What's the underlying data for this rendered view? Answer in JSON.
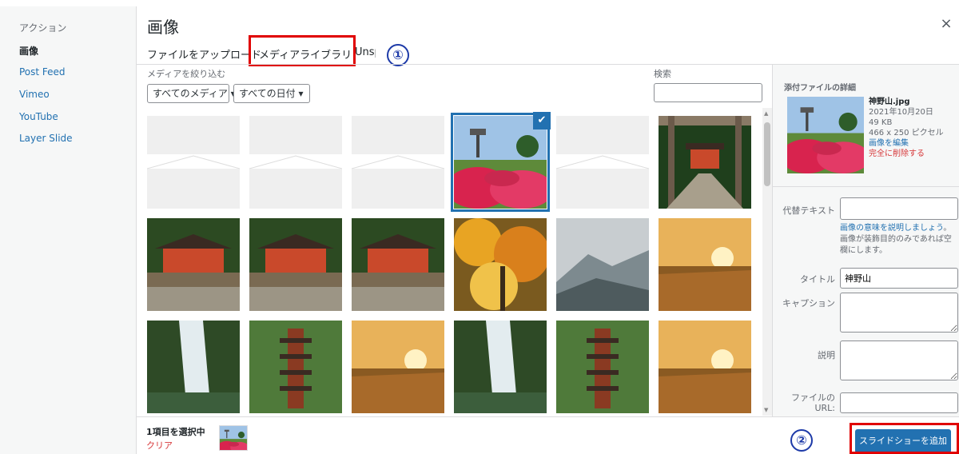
{
  "left_menu": {
    "heading": "アクション",
    "items": [
      {
        "label": "画像",
        "active": true
      },
      {
        "label": "Post Feed",
        "active": false
      },
      {
        "label": "Vimeo",
        "active": false
      },
      {
        "label": "YouTube",
        "active": false
      },
      {
        "label": "Layer Slide",
        "active": false
      }
    ]
  },
  "header": {
    "title": "画像",
    "close_icon": "×",
    "tabs": [
      "ファイルをアップロード",
      "メディアライブラリ",
      "Unsp"
    ],
    "active_tab": "メディアライブラリ",
    "step_badges": [
      "①",
      "②"
    ]
  },
  "filters": {
    "label": "メディアを絞り込む",
    "media_type": "すべてのメディア ▾",
    "date": "すべての日付 ▾",
    "search_label": "検索",
    "search_value": ""
  },
  "grid": {
    "thumbnails": [
      "placeholder-banner",
      "placeholder-banner",
      "placeholder-banner",
      "azalea-garden",
      "placeholder-banner",
      "shrine-gate",
      "shrine",
      "shrine",
      "shrine",
      "autumn-leaves",
      "misty-mountains",
      "sunset-field",
      "waterfall",
      "pagoda",
      "sunset-field",
      "waterfall",
      "pagoda",
      "sunset-field"
    ],
    "selected_index": 3,
    "check_icon": "✔"
  },
  "details": {
    "heading": "添付ファイルの詳細",
    "filename": "神野山.jpg",
    "date": "2021年10月20日",
    "size": "49 KB",
    "dimensions": "466 x 250 ピクセル",
    "edit_link": "画像を編集",
    "delete_link": "完全に削除する",
    "alt_label": "代替テキスト",
    "alt_value": "",
    "alt_help_link": "画像の意味を説明しましょう",
    "alt_help_rest": "。画像が装飾目的のみであれば空欄にします。",
    "title_label": "タイトル",
    "title_value": "神野山",
    "caption_label": "キャプション",
    "caption_value": "",
    "description_label": "説明",
    "description_value": "",
    "file_url_label": "ファイルの URL:",
    "file_url_value": ""
  },
  "footer": {
    "selected_count": "1項目を選択中",
    "clear": "クリア",
    "add_button": "スライドショーを追加"
  },
  "colors": {
    "accent": "#2271b1",
    "highlight": "#e00000",
    "badge": "#1d3aa8",
    "danger": "#d63638"
  }
}
